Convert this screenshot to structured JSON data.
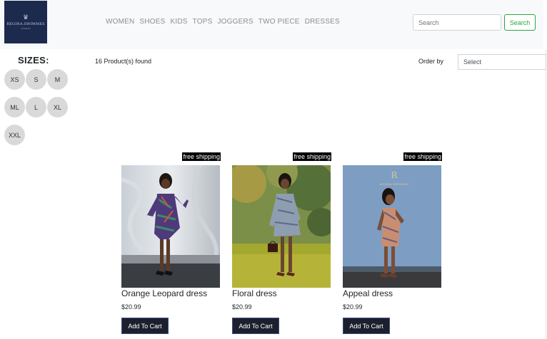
{
  "brand": {
    "logo_text": "REGINA.SWIMMES",
    "logo_sub": "FASHION"
  },
  "nav": [
    "WOMEN",
    "SHOES",
    "KIDS",
    "TOPS",
    "JOGGERS",
    "TWO PIECE",
    "DRESSES"
  ],
  "search": {
    "placeholder": "Search",
    "button_label": "Search"
  },
  "sizes": {
    "title": "SIZES:",
    "options": [
      "XS",
      "S",
      "M",
      "ML",
      "L",
      "XL",
      "XXL"
    ]
  },
  "toolbar": {
    "found_text": "16 Product(s) found",
    "order_label": "Order by",
    "order_value": "Select"
  },
  "products": [
    {
      "badge": "free shipping",
      "name": "Orange Leopard dress",
      "price": "$20.99",
      "button": "Add To Cart"
    },
    {
      "badge": "free shipping",
      "name": "Floral dress",
      "price": "$20.99",
      "button": "Add To Cart"
    },
    {
      "badge": "free shipping",
      "name": "Appeal dress",
      "price": "$20.99",
      "button": "Add To Cart"
    }
  ],
  "colors": {
    "header_bg": "#f8f9fa",
    "accent_green": "#28a745",
    "logo_bg": "#1c2a4e",
    "button_dark": "#1c1f2e",
    "size_circle": "#d9d9d9"
  }
}
